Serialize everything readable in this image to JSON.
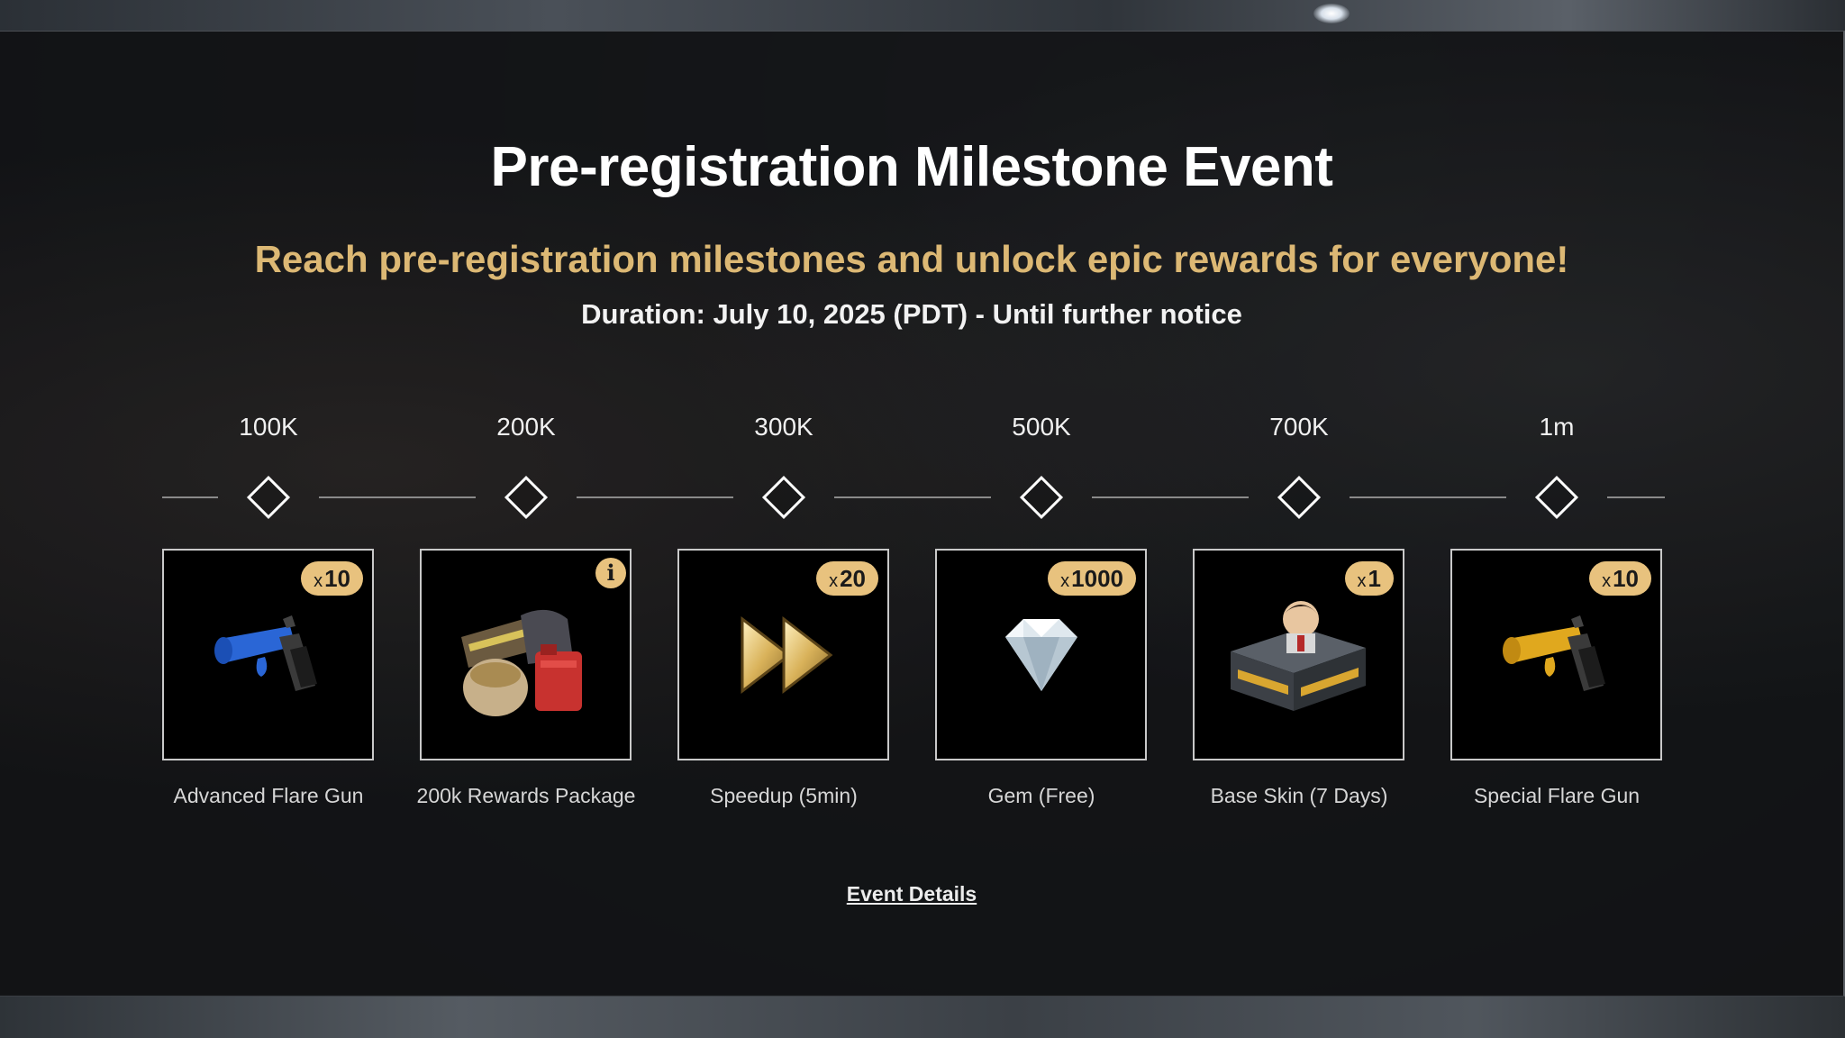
{
  "event": {
    "title": "Pre-registration Milestone Event",
    "subtitle": "Reach pre-registration milestones and unlock epic rewards for everyone!",
    "duration": "Duration: July 10, 2025 (PDT) - Until further notice",
    "details_link": "Event Details"
  },
  "milestones": [
    {
      "label": "100K",
      "reward": "Advanced Flare Gun",
      "quantity_prefix": "x",
      "quantity": "10",
      "icon": "blue-flare-gun-icon"
    },
    {
      "label": "200K",
      "reward": "200k Rewards Package",
      "info": "i",
      "icon": "rewards-package-icon"
    },
    {
      "label": "300K",
      "reward": "Speedup (5min)",
      "quantity_prefix": "x",
      "quantity": "20",
      "icon": "speedup-icon"
    },
    {
      "label": "500K",
      "reward": "Gem (Free)",
      "quantity_prefix": "x",
      "quantity": "1000",
      "icon": "gem-icon"
    },
    {
      "label": "700K",
      "reward": "Base Skin (7 Days)",
      "quantity_prefix": "x",
      "quantity": "1",
      "icon": "base-skin-icon"
    },
    {
      "label": "1m",
      "reward": "Special Flare Gun",
      "quantity_prefix": "x",
      "quantity": "10",
      "icon": "gold-flare-gun-icon"
    }
  ],
  "colors": {
    "accent_gold": "#dcb874",
    "badge_gold": "#e8c27e",
    "card_background": "#000000"
  }
}
